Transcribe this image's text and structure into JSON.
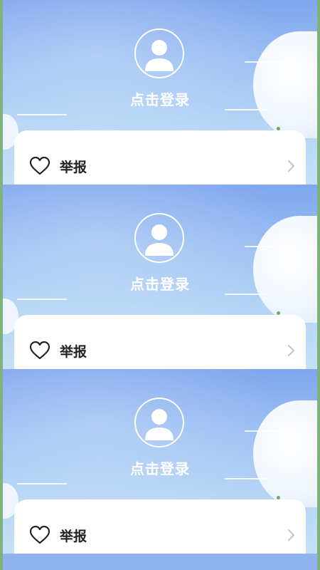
{
  "panels": [
    {
      "login_text": "点击登录",
      "menu": {
        "report_label": "举报",
        "heart_icon": "heart-outline-icon",
        "chevron_icon": "chevron-right-icon"
      }
    },
    {
      "login_text": "点击登录",
      "menu": {
        "report_label": "举报",
        "heart_icon": "heart-outline-icon",
        "chevron_icon": "chevron-right-icon"
      }
    },
    {
      "login_text": "点击登录",
      "menu": {
        "report_label": "举报",
        "heart_icon": "heart-outline-icon",
        "chevron_icon": "chevron-right-icon"
      }
    }
  ],
  "colors": {
    "border_green": "#7fb27c",
    "sky_top": "#7fa6ee",
    "sky_bottom": "#c6e0f7",
    "card_bg": "#ffffff",
    "text_dark": "#222222",
    "chevron": "#c0c4cc"
  }
}
